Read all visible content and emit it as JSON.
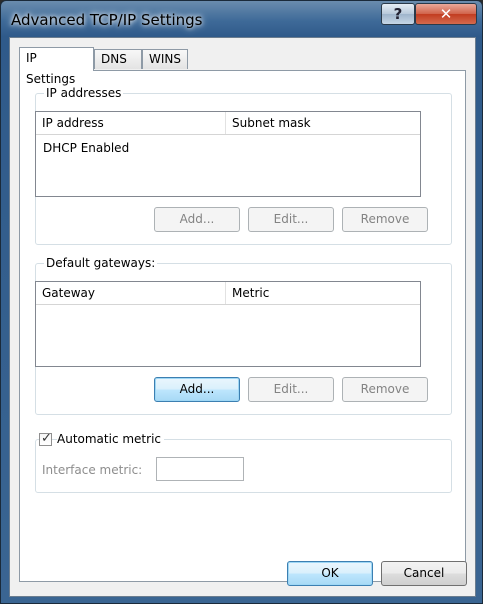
{
  "window": {
    "title": "Advanced TCP/IP Settings",
    "help_glyph": "?",
    "close_glyph": "✕"
  },
  "tabs": [
    {
      "label": "IP Settings"
    },
    {
      "label": "DNS"
    },
    {
      "label": "WINS"
    }
  ],
  "ip_addresses": {
    "group_label": "IP addresses",
    "columns": [
      "IP address",
      "Subnet mask"
    ],
    "rows": [
      [
        "DHCP Enabled",
        ""
      ]
    ],
    "buttons": {
      "add": "Add...",
      "edit": "Edit...",
      "remove": "Remove"
    }
  },
  "default_gateways": {
    "group_label": "Default gateways:",
    "columns": [
      "Gateway",
      "Metric"
    ],
    "rows": [],
    "buttons": {
      "add": "Add...",
      "edit": "Edit...",
      "remove": "Remove"
    }
  },
  "metric": {
    "automatic_label": "Automatic metric",
    "automatic_checked": true,
    "check_glyph": "✓",
    "interface_label": "Interface metric:",
    "interface_value": ""
  },
  "footer": {
    "ok": "OK",
    "cancel": "Cancel"
  }
}
